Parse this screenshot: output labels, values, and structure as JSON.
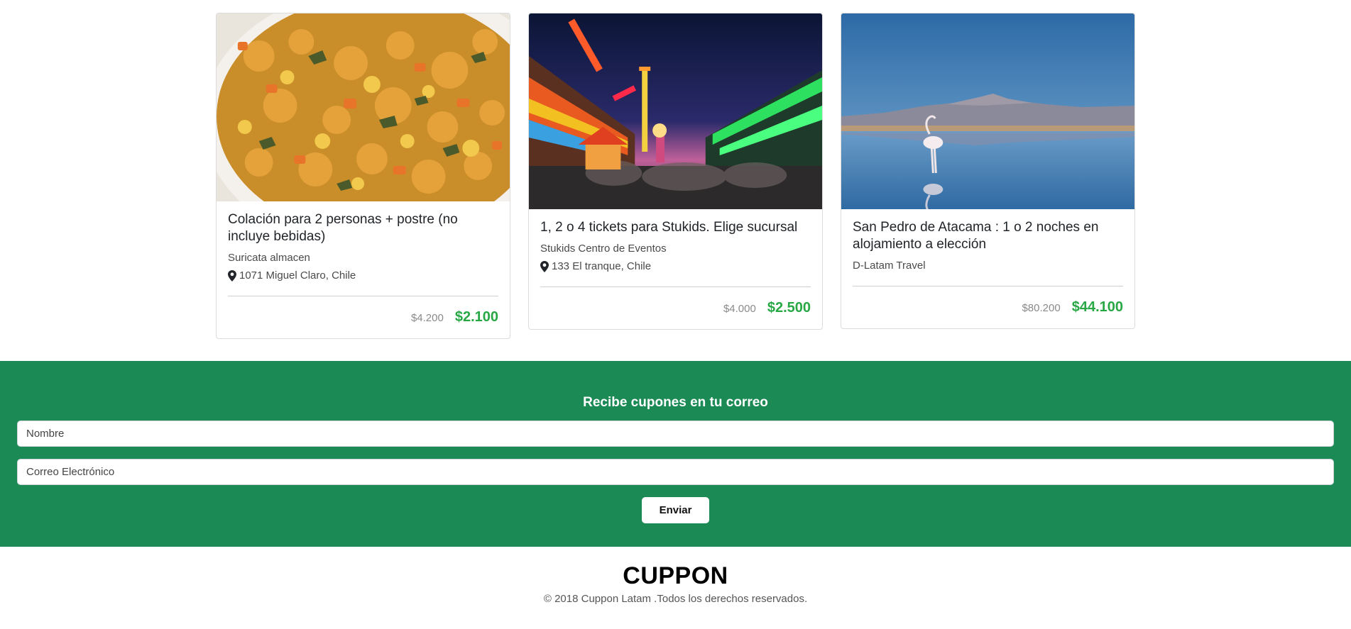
{
  "deals": [
    {
      "title": "Colación para 2 personas + postre (no incluye bebidas)",
      "merchant": "Suricata almacen",
      "location": "1071 Miguel Claro, Chile",
      "old_price": "$4.200",
      "new_price": "$2.100",
      "image": "food-dish-image"
    },
    {
      "title": "1, 2 o 4 tickets para Stukids. Elige sucursal",
      "merchant": "Stukids Centro de Eventos",
      "location": "133 El tranque, Chile",
      "old_price": "$4.000",
      "new_price": "$2.500",
      "image": "amusement-park-image"
    },
    {
      "title": "San Pedro de Atacama : 1 o 2 noches en alojamiento a elección",
      "merchant": "D-Latam Travel",
      "old_price": "$80.200",
      "new_price": "$44.100",
      "image": "flamingo-lake-image"
    }
  ],
  "newsletter": {
    "title": "Recibe cupones en tu correo",
    "name_placeholder": "Nombre",
    "email_placeholder": "Correo Electrónico",
    "submit_label": "Enviar"
  },
  "footer": {
    "brand": "CUPPON",
    "copyright": "© 2018 Cuppon Latam .Todos los derechos reservados."
  },
  "colors": {
    "newsletter_bg": "#1b8a55",
    "price_green": "#28a745"
  }
}
